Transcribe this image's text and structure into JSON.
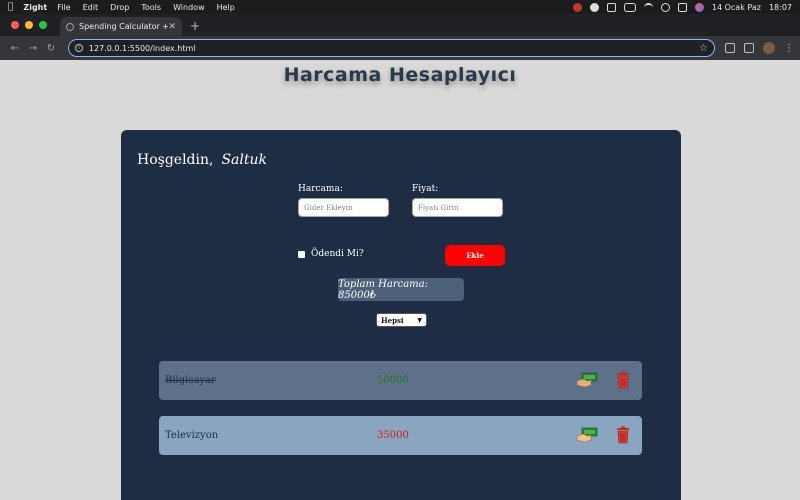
{
  "menubar": {
    "app_name": "Zight",
    "items": [
      "File",
      "Edit",
      "Drop",
      "Tools",
      "Window",
      "Help"
    ],
    "date": "14 Ocak Paz",
    "time": "18:07"
  },
  "browser": {
    "tab_title": "Spending Calculator +",
    "url": "127.0.0.1:5500/index.html"
  },
  "page": {
    "title": "Harcama Hesaplayıcı",
    "welcome": "Hoşgeldin,",
    "user_name": "Saltuk",
    "expense_label": "Harcama:",
    "expense_placeholder": "Gider Ekleyin",
    "price_label": "Fiyat:",
    "price_placeholder": "Fiyatı Girin",
    "paid_label": "Ödendi Mi?",
    "add_button": "Ekle",
    "total": "Toplam Harcama: 85000₺",
    "filter_selected": "Hepsi"
  },
  "items": [
    {
      "name": "Bilgisayar",
      "amount": "50000",
      "paid": true,
      "amount_color": "#1f7a1f",
      "bg": "#5e708a"
    },
    {
      "name": "Televizyon",
      "amount": "35000",
      "paid": false,
      "amount_color": "#d11a1a",
      "bg": "#8aa5c0"
    }
  ],
  "colors": {
    "card": "#1f2d44",
    "add_button": "#ff0000",
    "total_bg": "#4c6078"
  }
}
